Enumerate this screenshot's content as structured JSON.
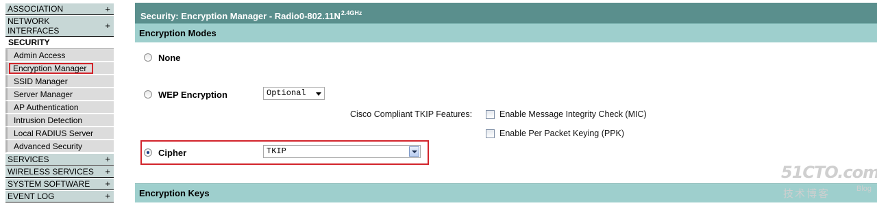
{
  "sidebar": {
    "categories_top": [
      {
        "label": "ASSOCIATION",
        "icon": "plus-icon"
      },
      {
        "label": "NETWORK INTERFACES",
        "icon": "plus-icon"
      }
    ],
    "security_label": "SECURITY",
    "security_items": [
      {
        "label": "Admin Access"
      },
      {
        "label": "Encryption Manager",
        "active": true
      },
      {
        "label": "SSID Manager"
      },
      {
        "label": "Server Manager"
      },
      {
        "label": "AP Authentication"
      },
      {
        "label": "Intrusion Detection"
      },
      {
        "label": "Local RADIUS Server"
      },
      {
        "label": "Advanced Security"
      }
    ],
    "categories_bottom": [
      {
        "label": "SERVICES",
        "icon": "plus-icon"
      },
      {
        "label": "WIRELESS SERVICES",
        "icon": "plus-icon"
      },
      {
        "label": "SYSTEM SOFTWARE",
        "icon": "plus-icon"
      },
      {
        "label": "EVENT LOG",
        "icon": "plus-icon"
      }
    ],
    "plus_symbol": "+",
    "network_interfaces_line1": "NETWORK",
    "network_interfaces_line2": "INTERFACES"
  },
  "header": {
    "title": "Security: Encryption Manager - Radio0-802.11N",
    "title_sup": "2.4GHz"
  },
  "encryption_modes": {
    "section_title": "Encryption Modes",
    "none_label": "None",
    "wep_label": "WEP Encryption",
    "wep_select_value": "Optional",
    "tkip_features_label": "Cisco Compliant TKIP Features:",
    "mic_label": "Enable Message Integrity Check (MIC)",
    "ppk_label": "Enable Per Packet Keying (PPK)",
    "cipher_label": "Cipher",
    "cipher_select_value": "TKIP",
    "selected_mode": "Cipher"
  },
  "encryption_keys": {
    "section_title": "Encryption Keys"
  },
  "watermark": {
    "main": "51CTO.com",
    "sub": "技术博客",
    "blog": "Blog"
  },
  "colors": {
    "title_bar": "#5a8f8d",
    "section_bar": "#9ecfcd",
    "sidebar_category": "#c7d7d6",
    "highlight": "#d2232a"
  }
}
